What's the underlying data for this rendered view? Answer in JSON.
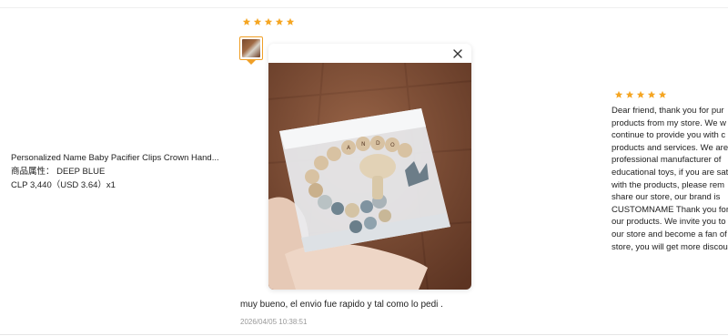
{
  "product": {
    "name": "Personalized Name Baby Pacifier Clips Crown Hand...",
    "attribute": "商品属性： DEEP BLUE",
    "price": "CLP 3,440（USD  3.64）x1"
  },
  "review": {
    "rating": 5,
    "text": "muy bueno, el envio fue rapido y tal como lo pedi .",
    "date": "2026/04/05 10:38:51"
  },
  "seller_reply": {
    "rating": 5,
    "lines": [
      "Dear friend, thank you for pur",
      "products from my store. We w",
      "continue to provide you with c",
      "products and services. We are",
      "professional manufacturer of",
      "educational toys, if you are sat",
      "with the products, please rem",
      "share our store, our brand is",
      "CUSTOMNAME Thank you for",
      "our products. We invite you to",
      "our store and become a fan of",
      "store, you will get more discou"
    ]
  },
  "colors": {
    "star": "#f5a623",
    "thumb_border": "#f0a028",
    "date": "#999999"
  },
  "icons": {
    "star": "star-icon",
    "close": "close-icon"
  }
}
